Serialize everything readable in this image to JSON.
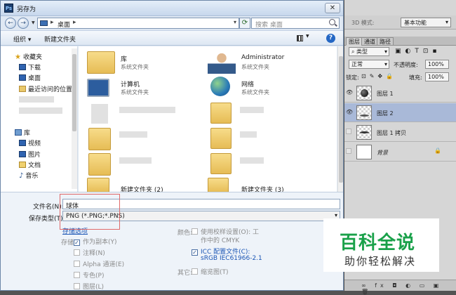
{
  "dialog": {
    "title": "另存为",
    "close_glyph": "✕",
    "back_glyph": "←",
    "forward_glyph": "→",
    "address": "桌面",
    "search_placeholder": "搜索 桌面",
    "toolbar": {
      "organize": "组织 ▾",
      "new_folder": "新建文件夹",
      "help_glyph": "?"
    },
    "sidebar": {
      "favorites_header": "收藏夹",
      "favorites": [
        "下载",
        "桌面",
        "最近访问的位置"
      ],
      "libraries_header": "库",
      "libraries": [
        "视频",
        "图片",
        "文档",
        "音乐"
      ]
    },
    "files": [
      {
        "name": "库",
        "sub": "系统文件夹",
        "icon": "library-icon"
      },
      {
        "name": "Administrator",
        "sub": "系统文件夹",
        "icon": "user-folder-icon"
      },
      {
        "name": "计算机",
        "sub": "系统文件夹",
        "icon": "computer-icon"
      },
      {
        "name": "网络",
        "sub": "系统文件夹",
        "icon": "network-icon"
      },
      {
        "name": "新建文件夹 (2)",
        "sub": "",
        "icon": "folder-icon"
      },
      {
        "name": "新建文件夹 (3)",
        "sub": "",
        "icon": "folder-icon"
      }
    ],
    "filename_label": "文件名(N):",
    "filename_value": "球体",
    "filetype_label": "保存类型(T):",
    "filetype_value": "PNG (*.PNG;*.PNS)",
    "save_options_link": "存储选项",
    "save_label": "存储:",
    "save_options": [
      {
        "label": "作为副本(Y)",
        "checked": true,
        "enabled": false
      },
      {
        "label": "注释(N)",
        "checked": false,
        "enabled": false
      },
      {
        "label": "Alpha 通道(E)",
        "checked": false,
        "enabled": false
      },
      {
        "label": "专色(P)",
        "checked": false,
        "enabled": false
      },
      {
        "label": "图层(L)",
        "checked": false,
        "enabled": false
      }
    ],
    "color_label": "颜色:",
    "proof_setup_line1": "使用校样设置(O): 工",
    "proof_setup_line2": "作中的 CMYK",
    "icc_line1": "ICC 配置文件(C):",
    "icc_line2": "sRGB IEC61966-2.1",
    "other_label": "其它:",
    "thumbnail_option": "缩览图(T)",
    "check_glyph": "✓"
  },
  "photoshop": {
    "mode_3d": "3D 模式:",
    "workspace": "基本功能",
    "tabs": [
      "图层",
      "通道",
      "路径"
    ],
    "kind_filter": "类型",
    "blend_mode": "正常",
    "opacity_label": "不透明度:",
    "opacity_value": "100%",
    "lock_label": "锁定:",
    "fill_label": "填充:",
    "fill_value": "100%",
    "eye_glyph": "👁",
    "lock_glyph": "🔒",
    "layers": [
      {
        "name": "图层 1",
        "visible": true,
        "selected": false
      },
      {
        "name": "图层 2",
        "visible": true,
        "selected": true
      },
      {
        "name": "图层 1 拷贝",
        "visible": false,
        "selected": false
      },
      {
        "name": "背景",
        "visible": false,
        "selected": false,
        "locked": true
      }
    ],
    "bottom_icons": "∞ fx ◘ ◐ ▭ ▣ 🗑"
  },
  "watermark": {
    "title": "百科全说",
    "subtitle": "助你轻松解决"
  }
}
